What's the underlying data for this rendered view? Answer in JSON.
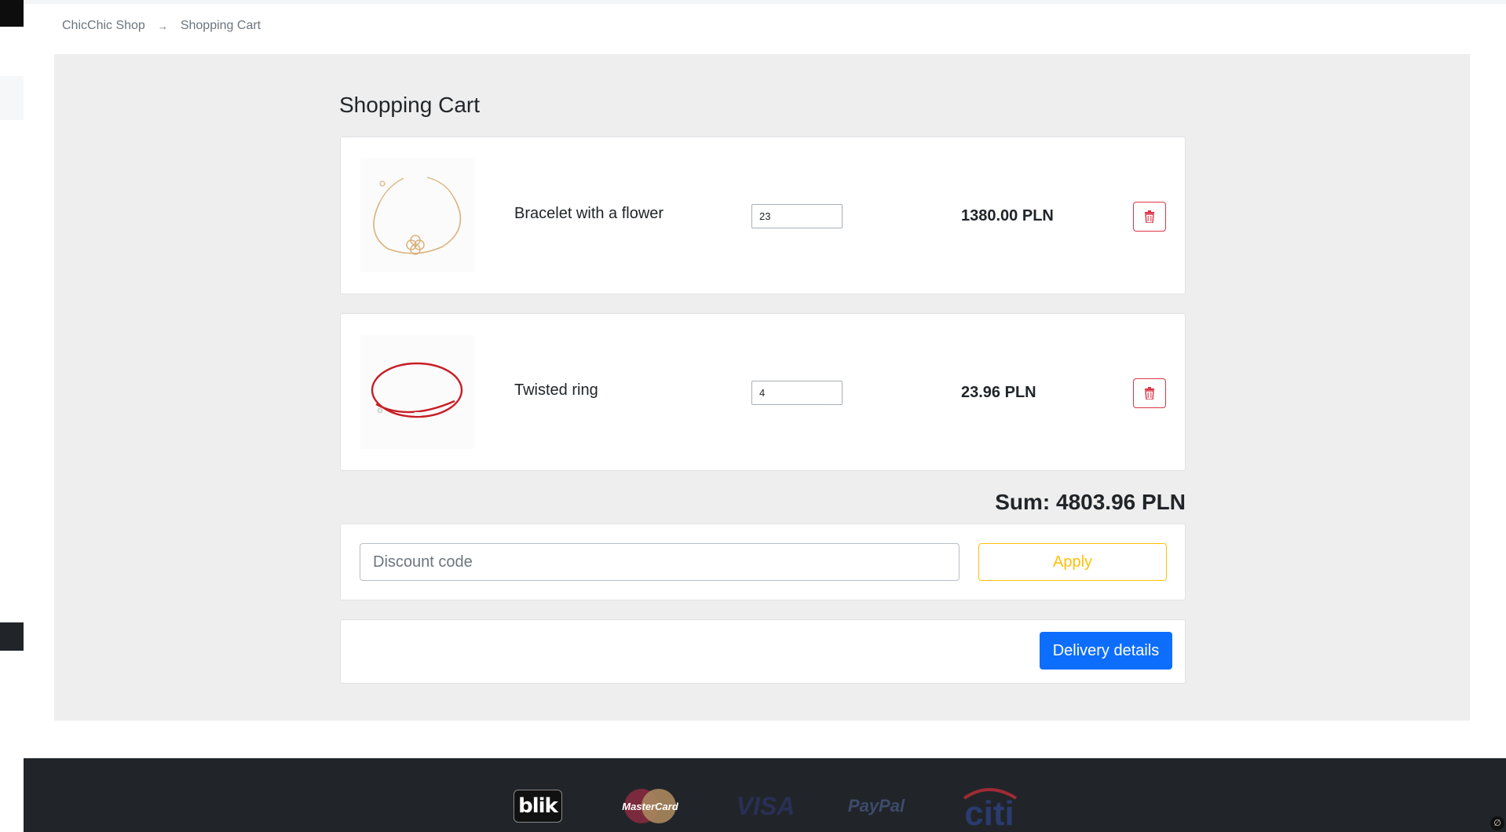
{
  "breadcrumb": {
    "home": "ChicChic Shop",
    "separator": "→",
    "current": "Shopping Cart"
  },
  "page_title": "Shopping Cart",
  "cart_items": [
    {
      "name": "Bracelet with a flower",
      "quantity": "23",
      "price": "1380.00 PLN",
      "image": "gold-bracelet-flower"
    },
    {
      "name": "Twisted ring",
      "quantity": "4",
      "price": "23.96 PLN",
      "image": "red-string-bracelet"
    }
  ],
  "sum_label": "Sum: 4803.96 PLN",
  "discount": {
    "placeholder": "Discount code",
    "apply_label": "Apply"
  },
  "delivery_label": "Delivery details",
  "footer": {
    "payment_logos": [
      "blik",
      "MasterCard",
      "VISA",
      "PayPal",
      "citi"
    ]
  },
  "colors": {
    "primary": "#0d6efd",
    "warning": "#ffc107",
    "danger": "#dc3545",
    "panel_bg": "#eeeeee",
    "footer_bg": "#212529"
  }
}
